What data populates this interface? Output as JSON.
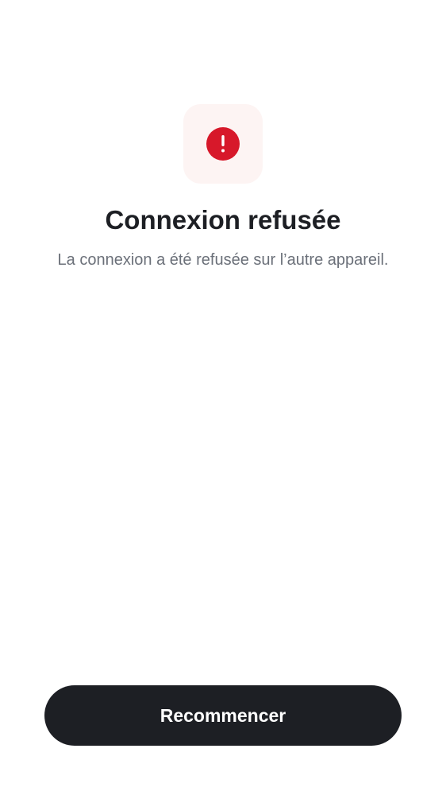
{
  "status": {
    "icon": "alert-circle-icon",
    "title": "Connexion refusée",
    "message": "La connexion a été refusée sur l’autre appareil."
  },
  "actions": {
    "restart_label": "Recommencer"
  },
  "colors": {
    "background": "#ffffff",
    "icon_tile": "#fdf4f3",
    "alert_red": "#d7182a",
    "title_text": "#1d1f24",
    "message_text": "#6b7079",
    "button_bg": "#1d1f24",
    "button_text": "#ffffff"
  }
}
